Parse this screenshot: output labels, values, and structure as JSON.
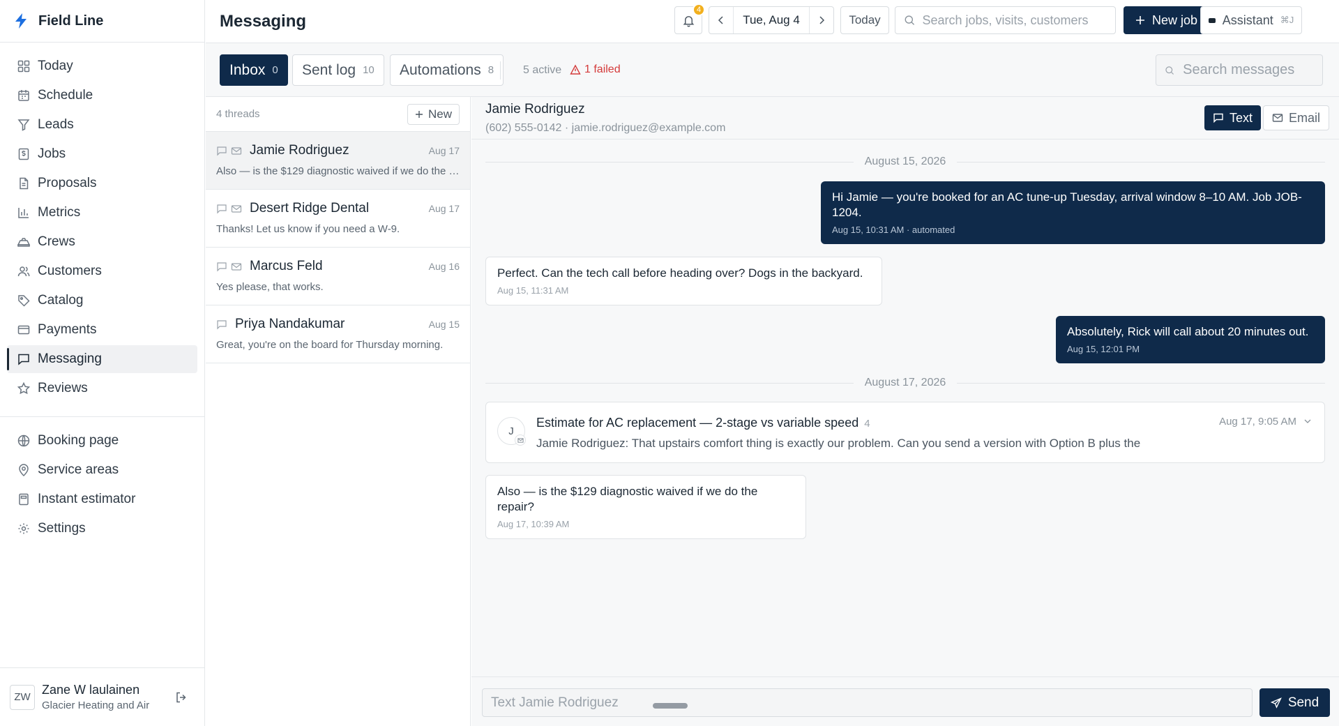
{
  "app": {
    "name": "Field Line",
    "accent": "#0f2a4a",
    "brand_icon": "bolt-icon"
  },
  "sidebar": {
    "items": [
      {
        "label": "Today",
        "icon": "grid-icon"
      },
      {
        "label": "Schedule",
        "icon": "calendar-icon"
      },
      {
        "label": "Leads",
        "icon": "funnel-icon"
      },
      {
        "label": "Jobs",
        "icon": "dollar-doc-icon"
      },
      {
        "label": "Proposals",
        "icon": "document-icon"
      },
      {
        "label": "Metrics",
        "icon": "bar-chart-icon"
      },
      {
        "label": "Crews",
        "icon": "truck-icon"
      },
      {
        "label": "Customers",
        "icon": "users-icon"
      },
      {
        "label": "Catalog",
        "icon": "tag-icon"
      },
      {
        "label": "Payments",
        "icon": "card-icon"
      },
      {
        "label": "Messaging",
        "icon": "chat-icon"
      },
      {
        "label": "Reviews",
        "icon": "star-icon"
      }
    ],
    "secondary": [
      {
        "label": "Booking page",
        "icon": "globe-icon"
      },
      {
        "label": "Service areas",
        "icon": "pin-icon"
      },
      {
        "label": "Instant estimator",
        "icon": "calculator-icon"
      },
      {
        "label": "Settings",
        "icon": "gear-icon"
      }
    ],
    "user": {
      "initials": "ZW",
      "name": "Zane W laulainen",
      "org": "Glacier Heating and Air"
    }
  },
  "header": {
    "title": "Messaging",
    "notifications": "4",
    "date": "Tue, Aug 4",
    "today_label": "Today",
    "search_placeholder": "Search jobs, visits, customers",
    "new_job_label": "New job",
    "assistant_label": "Assistant",
    "assistant_shortcut": "⌘J"
  },
  "tabs": [
    {
      "label": "Inbox",
      "count": "0"
    },
    {
      "label": "Sent log",
      "count": "10"
    },
    {
      "label": "Automations",
      "count": "8"
    }
  ],
  "automation_status": {
    "active": "5 active",
    "failed": "1 failed"
  },
  "message_search_placeholder": "Search messages",
  "threads": {
    "count_label": "4 threads",
    "new_label": "New",
    "items": [
      {
        "name": "Jamie Rodriguez",
        "date": "Aug 17",
        "preview": "Also — is the $129 diagnostic waived if we do the repair?",
        "email": true
      },
      {
        "name": "Desert Ridge Dental",
        "date": "Aug 17",
        "preview": "Thanks! Let us know if you need a W-9.",
        "email": true
      },
      {
        "name": "Marcus Feld",
        "date": "Aug 16",
        "preview": "Yes please, that works.",
        "email": true
      },
      {
        "name": "Priya Nandakumar",
        "date": "Aug 15",
        "preview": "Great, you're on the board for Thursday morning.",
        "email": false
      }
    ]
  },
  "conversation": {
    "name": "Jamie Rodriguez",
    "contact": "(602) 555-0142 · jamie.rodriguez@example.com",
    "text_label": "Text",
    "email_label": "Email",
    "day1": "August 15, 2026",
    "day2": "August 17, 2026",
    "messages": [
      {
        "text": "Hi Jamie — you're booked for an AC tune-up Tuesday, arrival window 8–10 AM. Job JOB-1204.",
        "meta": "Aug 15, 10:31 AM · automated"
      },
      {
        "text": "Perfect. Can the tech call before heading over? Dogs in the backyard.",
        "meta": "Aug 15, 11:31 AM"
      },
      {
        "text": "Absolutely, Rick will call about 20 minutes out.",
        "meta": "Aug 15, 12:01 PM"
      },
      {
        "text": "Also — is the $129 diagnostic waived if we do the repair?",
        "meta": "Aug 17, 10:39 AM"
      }
    ],
    "email_thread": {
      "initial": "J",
      "subject": "Estimate for AC replacement — 2-stage vs variable speed",
      "count": "4",
      "snippet": "Jamie Rodriguez: That upstairs comfort thing is exactly our problem. Can you send a version with Option B plus the",
      "date": "Aug 17, 9:05 AM"
    },
    "composer_placeholder": "Text Jamie Rodriguez",
    "send_label": "Send"
  }
}
